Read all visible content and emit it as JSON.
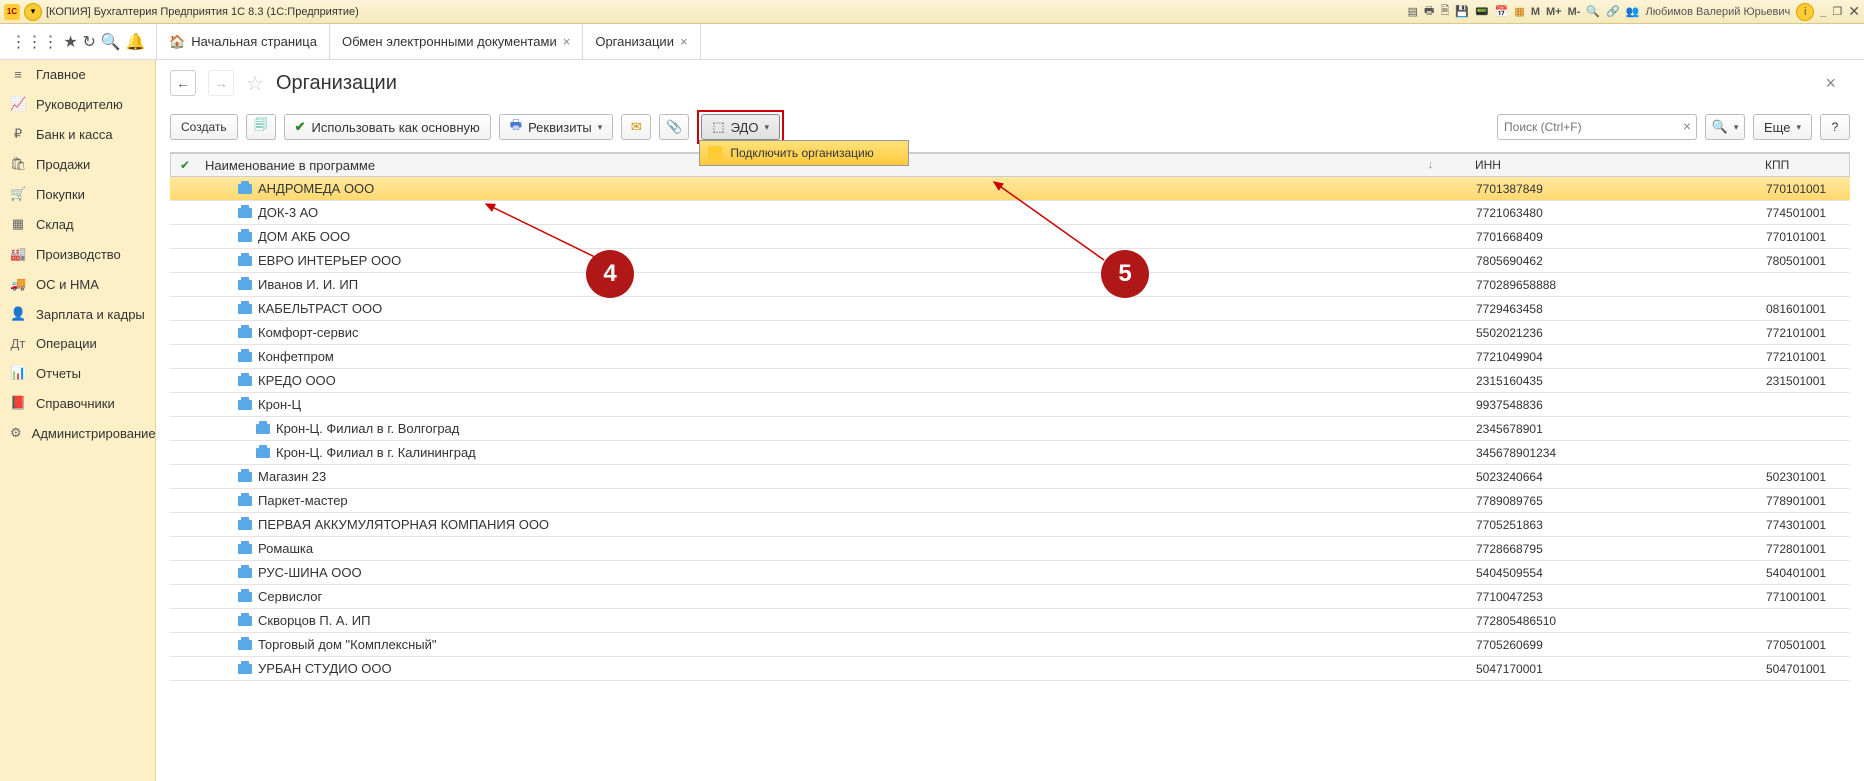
{
  "titlebar": {
    "logo_text": "1C",
    "title": "[КОПИЯ] Бухгалтерия Предприятия 1С 8.3  (1С:Предприятие)",
    "user": "Любимов Валерий Юрьевич",
    "m1": "M",
    "m2": "M+",
    "m3": "M-"
  },
  "tabs": [
    {
      "label": "Начальная страница",
      "closable": false,
      "home": true
    },
    {
      "label": "Обмен электронными документами",
      "closable": true
    },
    {
      "label": "Организации",
      "closable": true,
      "active": true
    }
  ],
  "sidebar": [
    {
      "icon": "≡",
      "label": "Главное"
    },
    {
      "icon": "📈",
      "label": "Руководителю"
    },
    {
      "icon": "₽",
      "label": "Банк и касса"
    },
    {
      "icon": "🛍",
      "label": "Продажи"
    },
    {
      "icon": "🛒",
      "label": "Покупки"
    },
    {
      "icon": "▦",
      "label": "Склад"
    },
    {
      "icon": "🏭",
      "label": "Производство"
    },
    {
      "icon": "🚚",
      "label": "ОС и НМА"
    },
    {
      "icon": "👤",
      "label": "Зарплата и кадры"
    },
    {
      "icon": "Дт",
      "label": "Операции"
    },
    {
      "icon": "📊",
      "label": "Отчеты"
    },
    {
      "icon": "📕",
      "label": "Справочники"
    },
    {
      "icon": "⚙",
      "label": "Администрирование"
    }
  ],
  "page": {
    "title": "Организации",
    "btn_create": "Создать",
    "btn_main": "Использовать как основную",
    "btn_req": "Реквизиты",
    "btn_edo": "ЭДО",
    "dd_connect": "Подключить организацию",
    "search_ph": "Поиск (Ctrl+F)",
    "btn_more": "Еще"
  },
  "table": {
    "hdr_name": "Наименование в программе",
    "hdr_inn": "ИНН",
    "hdr_kpp": "КПП",
    "rows": [
      {
        "name": "АНДРОМЕДА ООО",
        "inn": "7701387849",
        "kpp": "770101001",
        "selected": true
      },
      {
        "name": "ДОК-3 АО",
        "inn": "7721063480",
        "kpp": "774501001"
      },
      {
        "name": "ДОМ АКБ ООО",
        "inn": "7701668409",
        "kpp": "770101001"
      },
      {
        "name": "ЕВРО ИНТЕРЬЕР ООО",
        "inn": "7805690462",
        "kpp": "780501001"
      },
      {
        "name": "Иванов И. И. ИП",
        "inn": "770289658888",
        "kpp": ""
      },
      {
        "name": "КАБЕЛЬТРАСТ ООО",
        "inn": "7729463458",
        "kpp": "081601001"
      },
      {
        "name": "Комфорт-сервис",
        "inn": "5502021236",
        "kpp": "772101001"
      },
      {
        "name": "Конфетпром",
        "inn": "7721049904",
        "kpp": "772101001"
      },
      {
        "name": "КРЕДО ООО",
        "inn": "2315160435",
        "kpp": "231501001"
      },
      {
        "name": "Крон-Ц",
        "inn": "9937548836",
        "kpp": ""
      },
      {
        "name": "Крон-Ц. Филиал в г. Волгоград",
        "inn": "2345678901",
        "kpp": "",
        "level2": true
      },
      {
        "name": "Крон-Ц. Филиал в г. Калининград",
        "inn": "345678901234",
        "kpp": "",
        "level2": true
      },
      {
        "name": "Магазин 23",
        "inn": "5023240664",
        "kpp": "502301001"
      },
      {
        "name": "Паркет-мастер",
        "inn": "7789089765",
        "kpp": "778901001"
      },
      {
        "name": "ПЕРВАЯ АККУМУЛЯТОРНАЯ КОМПАНИЯ ООО",
        "inn": "7705251863",
        "kpp": "774301001"
      },
      {
        "name": "Ромашка",
        "inn": "7728668795",
        "kpp": "772801001"
      },
      {
        "name": "РУС-ШИНА ООО",
        "inn": "5404509554",
        "kpp": "540401001"
      },
      {
        "name": "Сервислог",
        "inn": "7710047253",
        "kpp": "771001001"
      },
      {
        "name": "Скворцов П. А. ИП",
        "inn": "772805486510",
        "kpp": ""
      },
      {
        "name": "Торговый дом \"Комплексный\"",
        "inn": "7705260699",
        "kpp": "770501001"
      },
      {
        "name": "УРБАН СТУДИО ООО",
        "inn": "5047170001",
        "kpp": "504701001"
      }
    ]
  },
  "annot": {
    "a4": "4",
    "a5": "5"
  }
}
